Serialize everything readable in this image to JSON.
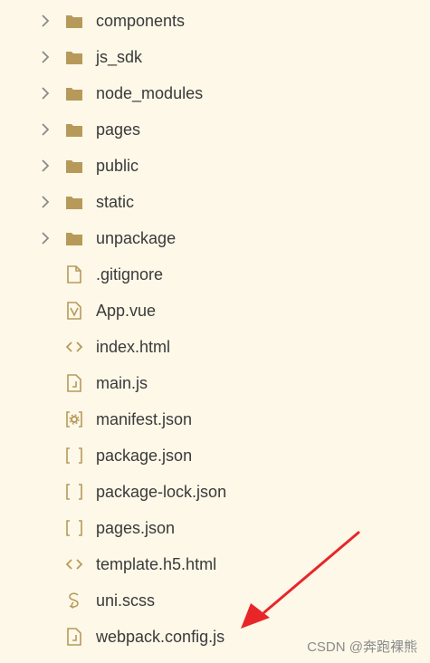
{
  "tree": {
    "items": [
      {
        "name": "components",
        "type": "folder",
        "icon": "folder-icon"
      },
      {
        "name": "js_sdk",
        "type": "folder",
        "icon": "folder-icon"
      },
      {
        "name": "node_modules",
        "type": "folder",
        "icon": "folder-icon"
      },
      {
        "name": "pages",
        "type": "folder",
        "icon": "folder-icon"
      },
      {
        "name": "public",
        "type": "folder",
        "icon": "folder-icon"
      },
      {
        "name": "static",
        "type": "folder",
        "icon": "folder-icon"
      },
      {
        "name": "unpackage",
        "type": "folder",
        "icon": "folder-icon"
      },
      {
        "name": ".gitignore",
        "type": "file",
        "icon": "blank-file-icon"
      },
      {
        "name": "App.vue",
        "type": "file",
        "icon": "vue-file-icon"
      },
      {
        "name": "index.html",
        "type": "file",
        "icon": "html-file-icon"
      },
      {
        "name": "main.js",
        "type": "file",
        "icon": "js-file-icon"
      },
      {
        "name": "manifest.json",
        "type": "file",
        "icon": "manifest-file-icon"
      },
      {
        "name": "package.json",
        "type": "file",
        "icon": "json-file-icon"
      },
      {
        "name": "package-lock.json",
        "type": "file",
        "icon": "json-file-icon"
      },
      {
        "name": "pages.json",
        "type": "file",
        "icon": "json-file-icon"
      },
      {
        "name": "template.h5.html",
        "type": "file",
        "icon": "html-file-icon"
      },
      {
        "name": "uni.scss",
        "type": "file",
        "icon": "scss-file-icon"
      },
      {
        "name": "webpack.config.js",
        "type": "file",
        "icon": "js-file-icon"
      }
    ]
  },
  "watermark": "CSDN @奔跑裸熊",
  "colors": {
    "background": "#fdf8e8",
    "icon": "#b79a5a",
    "chevron": "#8a8a8a",
    "text": "#3a3a3a",
    "arrow": "#e8262a"
  }
}
